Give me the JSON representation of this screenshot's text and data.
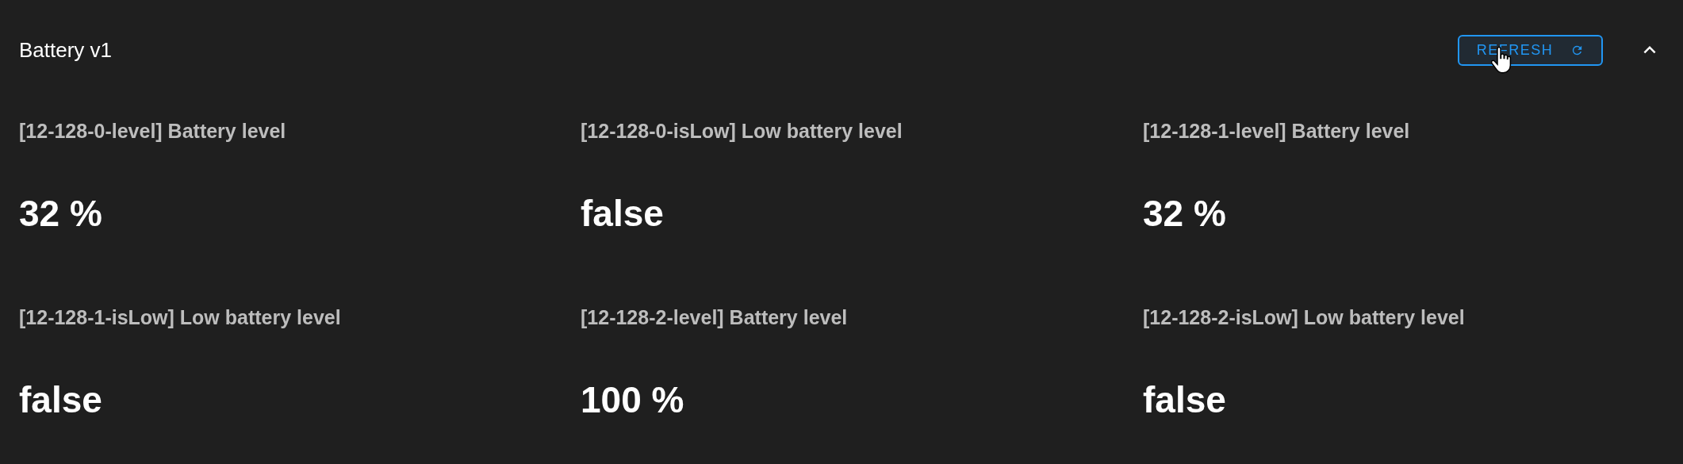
{
  "panel": {
    "title": "Battery v1",
    "expanded": true,
    "refresh_button": {
      "label": "REFRESH",
      "hovered": true
    }
  },
  "values": [
    {
      "label": "[12-128-0-level] Battery level",
      "value": "32 %"
    },
    {
      "label": "[12-128-0-isLow] Low battery level",
      "value": "false"
    },
    {
      "label": "[12-128-1-level] Battery level",
      "value": "32 %"
    },
    {
      "label": "[12-128-1-isLow] Low battery level",
      "value": "false"
    },
    {
      "label": "[12-128-2-level] Battery level",
      "value": "100 %"
    },
    {
      "label": "[12-128-2-isLow] Low battery level",
      "value": "false"
    }
  ]
}
